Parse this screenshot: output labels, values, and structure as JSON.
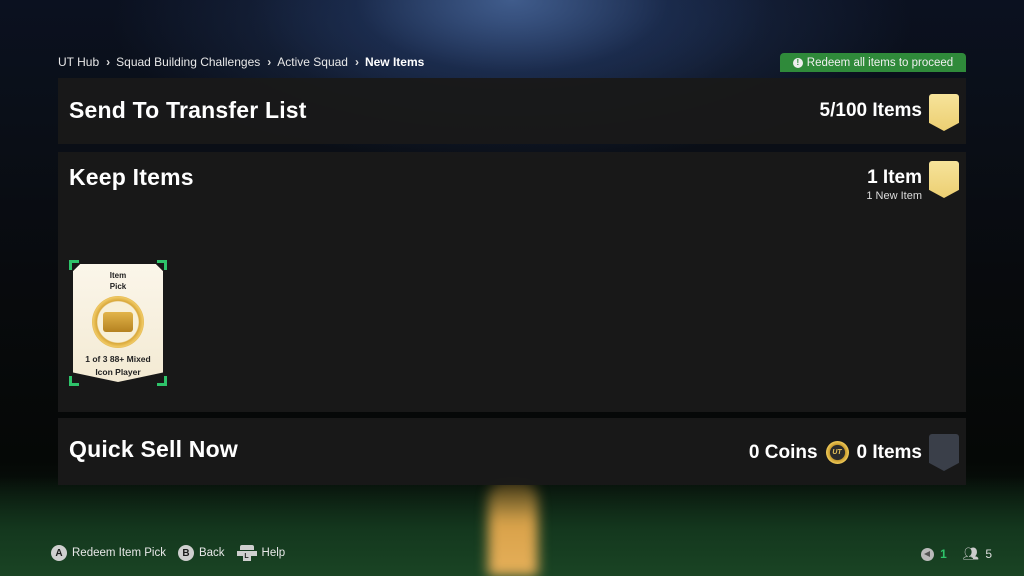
{
  "breadcrumb": [
    {
      "label": "UT Hub"
    },
    {
      "label": "Squad Building Challenges"
    },
    {
      "label": "Active Squad"
    },
    {
      "label": "New Items",
      "current": true
    }
  ],
  "notice": {
    "icon": "exclamation-circle-icon",
    "text": "Redeem all items to proceed",
    "color": "#2f8a3a"
  },
  "sections": {
    "transfer": {
      "title": "Send To Transfer List",
      "count": "5/100 Items",
      "icon": "gold-shield-icon"
    },
    "keep": {
      "title": "Keep Items",
      "count": "1 Item",
      "subcount": "1 New Item",
      "icon": "gold-shield-icon",
      "items": [
        {
          "title_line1": "Item",
          "title_line2": "Pick",
          "desc_line1": "1 of 3 88+ Mixed",
          "desc_line2": "Icon Player",
          "selected": true
        }
      ]
    },
    "quick_sell": {
      "title": "Quick Sell Now",
      "coins": "0 Coins",
      "coin_icon_text": "UT",
      "count": "0 Items",
      "icon": "grey-shield-icon"
    }
  },
  "footer": {
    "hints": [
      {
        "glyph": "A",
        "label": "Redeem Item Pick"
      },
      {
        "glyph": "B",
        "label": "Back"
      },
      {
        "glyph": "L",
        "label": "Help"
      }
    ],
    "status": {
      "voice_count": "1",
      "party_count": "5"
    }
  },
  "colors": {
    "accent_green": "#2ec36a",
    "gold": "#eccf72",
    "panel": "#191919"
  }
}
